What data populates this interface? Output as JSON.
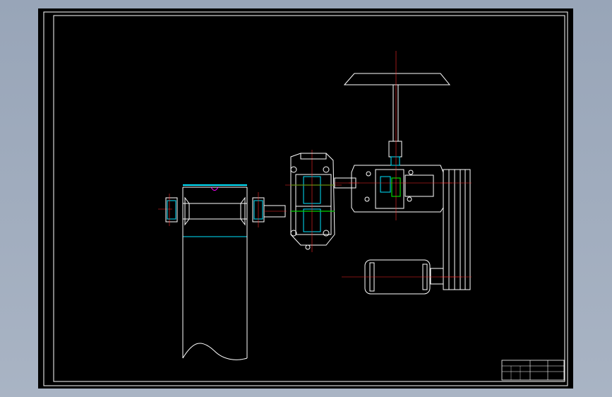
{
  "viewport": {
    "background": "#a3afc0",
    "canvas_background": "#000000"
  },
  "colors": {
    "outline": "#ffffff",
    "centerline": "#ff2a2a",
    "bearing": "#00e5ff",
    "gear": "#00d400",
    "magenta_mark": "#ff00ff"
  },
  "components": {
    "drum": "drum-conveyor",
    "gearbox": "two-stage-gear-reducer",
    "bevel_box": "bevel-gear-box",
    "fan": "fan-blade",
    "motor": "electric-motor",
    "pulley": "v-belt-pulley"
  },
  "title_block": {
    "cell_1": "",
    "cell_2": "",
    "cell_3": "",
    "cell_4": ""
  }
}
